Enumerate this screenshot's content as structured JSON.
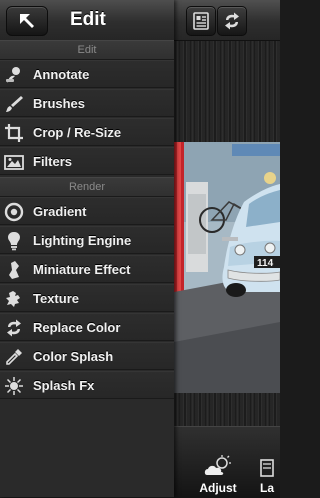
{
  "panel": {
    "title": "Edit",
    "sections": [
      {
        "header": "Edit"
      },
      {
        "header": "Render"
      }
    ],
    "edit_items": [
      {
        "label": "Annotate",
        "icon": "annotate-icon"
      },
      {
        "label": "Brushes",
        "icon": "brush-icon"
      },
      {
        "label": "Crop / Re-Size",
        "icon": "crop-icon"
      },
      {
        "label": "Filters",
        "icon": "filters-icon"
      }
    ],
    "render_items": [
      {
        "label": "Gradient",
        "icon": "gradient-icon"
      },
      {
        "label": "Lighting Engine",
        "icon": "bulb-icon"
      },
      {
        "label": "Miniature Effect",
        "icon": "miniature-icon"
      },
      {
        "label": "Texture",
        "icon": "texture-icon"
      },
      {
        "label": "Replace Color",
        "icon": "replace-color-icon"
      },
      {
        "label": "Color Splash",
        "icon": "dropper-icon"
      },
      {
        "label": "Splash Fx",
        "icon": "splash-icon"
      }
    ]
  },
  "bottom_toolbar": {
    "adjust_label": "Adjust",
    "layers_label": "La"
  },
  "photo_plate_text": "114",
  "colors": {
    "panel_bg": "#2a2a2a",
    "header_text": "#ffffff",
    "section_text": "#8a8a8a"
  }
}
